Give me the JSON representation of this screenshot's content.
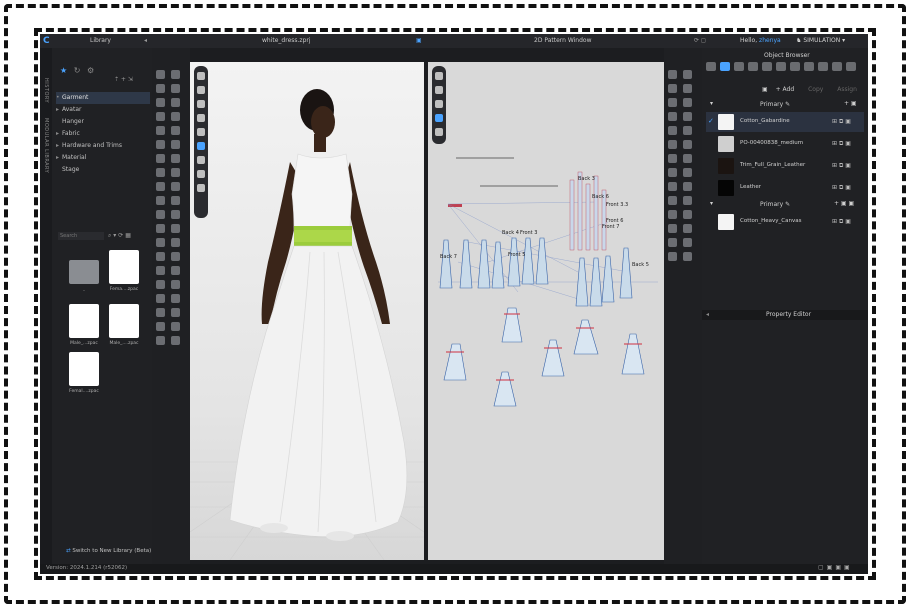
{
  "app": {
    "viewport_title": "white_dress.zprj",
    "pattern_title": "2D Pattern Window",
    "greeting": "Hello,",
    "username": "zhenya",
    "mode": "SIMULATION",
    "version": "Version: 2024.1.214 (r52062)"
  },
  "library": {
    "title": "Library",
    "side_tabs": [
      "HISTORY",
      "MODULAR LIBRARY"
    ],
    "tree": [
      "Garment",
      "Avatar",
      "Hanger",
      "Fabric",
      "Hardware and Trims",
      "Material",
      "Stage"
    ],
    "search_placeholder": "Search",
    "files": [
      {
        "name": "..",
        "kind": "folder"
      },
      {
        "name": "Fema....zpac",
        "kind": "garment"
      },
      {
        "name": "Male_...zpac",
        "kind": "garment"
      },
      {
        "name": "Male_....zpac",
        "kind": "garment"
      },
      {
        "name": "Femal....zpac",
        "kind": "garment"
      }
    ],
    "switch_label": "Switch to New Library (Beta)"
  },
  "object_browser": {
    "title": "Object Browser",
    "add_label": "+ Add",
    "copy_label": "Copy",
    "assign_label": "Assign",
    "primary_label": "Primary",
    "fabrics": [
      {
        "name": "Cotton_Gabardine",
        "color": "#f4f4f4",
        "selected": true
      },
      {
        "name": "PO-00400838_medium",
        "color": "#cfcfcf",
        "selected": false
      },
      {
        "name": "Trim_Full_Grain_Leather",
        "color": "#1b1411",
        "selected": false
      },
      {
        "name": "Leather",
        "color": "#050505",
        "selected": false
      }
    ],
    "group2_label": "Primary",
    "group2_fabrics": [
      {
        "name": "Cotton_Heavy_Canvas",
        "color": "#f4f4f4"
      }
    ],
    "property_editor": "Property Editor"
  },
  "pattern_labels": [
    "Back 4",
    "Front 3",
    "Back 7",
    "Front 5",
    "Back 6",
    "Front 6",
    "Back 5",
    "Front 4",
    "Front 7",
    "Back 3",
    "Front 3.3"
  ],
  "colors": {
    "accent": "#4aa3ff",
    "belt": "#9bcc3c"
  }
}
